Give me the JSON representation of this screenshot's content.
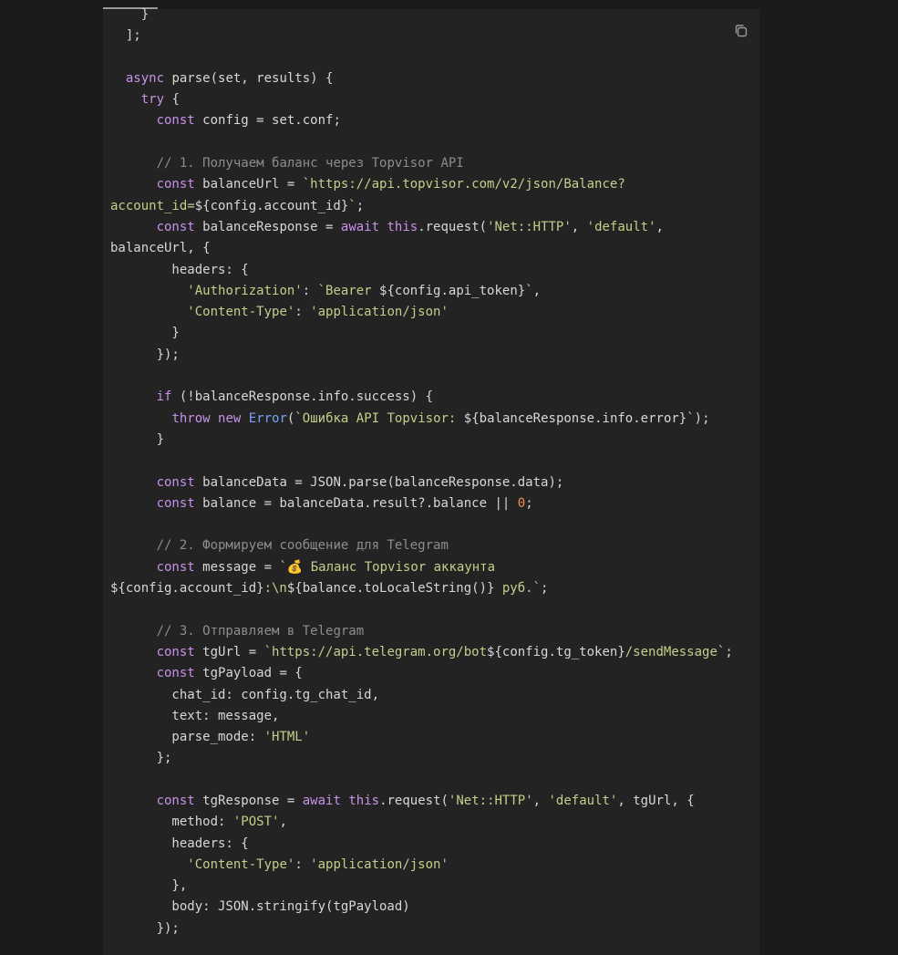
{
  "copy_button": {
    "icon": "copy-icon"
  },
  "colors": {
    "background": "#1b1b1b",
    "panel": "#232323",
    "keyword": "#c792ea",
    "string": "#c3cf8a",
    "comment": "#8d8d8d",
    "number": "#f08a4b",
    "class": "#7aa2f7",
    "text": "#d7d7d7"
  },
  "code_lines": [
    [
      [
        "pl",
        "    }"
      ]
    ],
    [
      [
        "pl",
        "  ];"
      ]
    ],
    [
      [
        "pl",
        ""
      ]
    ],
    [
      [
        "pl",
        "  "
      ],
      [
        "kw",
        "async"
      ],
      [
        "pl",
        " parse(set, results) {"
      ]
    ],
    [
      [
        "pl",
        "    "
      ],
      [
        "kw",
        "try"
      ],
      [
        "pl",
        " {"
      ]
    ],
    [
      [
        "pl",
        "      "
      ],
      [
        "kw",
        "const"
      ],
      [
        "pl",
        " config = set.conf;"
      ]
    ],
    [
      [
        "pl",
        ""
      ]
    ],
    [
      [
        "pl",
        "      "
      ],
      [
        "cm",
        "// 1. Получаем баланс через Topvisor API"
      ]
    ],
    [
      [
        "pl",
        "      "
      ],
      [
        "kw",
        "const"
      ],
      [
        "pl",
        " balanceUrl = "
      ],
      [
        "str",
        "`https://api.topvisor.com/v2/json/Balance?"
      ]
    ],
    [
      [
        "str",
        "account_id="
      ],
      [
        "pl",
        "${config.account_id}"
      ],
      [
        "str",
        "`"
      ],
      [
        "pl",
        ";"
      ]
    ],
    [
      [
        "pl",
        "      "
      ],
      [
        "kw",
        "const"
      ],
      [
        "pl",
        " balanceResponse = "
      ],
      [
        "kw",
        "await"
      ],
      [
        "pl",
        " "
      ],
      [
        "kw",
        "this"
      ],
      [
        "pl",
        ".request("
      ],
      [
        "str",
        "'Net::HTTP'"
      ],
      [
        "pl",
        ", "
      ],
      [
        "str",
        "'default'"
      ],
      [
        "pl",
        ","
      ]
    ],
    [
      [
        "pl",
        "balanceUrl, {"
      ]
    ],
    [
      [
        "pl",
        "        headers: {"
      ]
    ],
    [
      [
        "pl",
        "          "
      ],
      [
        "str",
        "'Authorization'"
      ],
      [
        "pl",
        ": "
      ],
      [
        "str",
        "`Bearer "
      ],
      [
        "pl",
        "${config.api_token}"
      ],
      [
        "str",
        "`"
      ],
      [
        "pl",
        ","
      ]
    ],
    [
      [
        "pl",
        "          "
      ],
      [
        "str",
        "'Content-Type'"
      ],
      [
        "pl",
        ": "
      ],
      [
        "str",
        "'application/json'"
      ]
    ],
    [
      [
        "pl",
        "        }"
      ]
    ],
    [
      [
        "pl",
        "      });"
      ]
    ],
    [
      [
        "pl",
        ""
      ]
    ],
    [
      [
        "pl",
        "      "
      ],
      [
        "kw",
        "if"
      ],
      [
        "pl",
        " (!balanceResponse.info.success) {"
      ]
    ],
    [
      [
        "pl",
        "        "
      ],
      [
        "kw",
        "throw"
      ],
      [
        "pl",
        " "
      ],
      [
        "kw",
        "new"
      ],
      [
        "pl",
        " "
      ],
      [
        "cls",
        "Error"
      ],
      [
        "pl",
        "("
      ],
      [
        "str",
        "`Ошибка API Topvisor: "
      ],
      [
        "pl",
        "${balanceResponse.info.error}"
      ],
      [
        "str",
        "`"
      ],
      [
        "pl",
        ");"
      ]
    ],
    [
      [
        "pl",
        "      }"
      ]
    ],
    [
      [
        "pl",
        ""
      ]
    ],
    [
      [
        "pl",
        "      "
      ],
      [
        "kw",
        "const"
      ],
      [
        "pl",
        " balanceData = JSON.parse(balanceResponse.data);"
      ]
    ],
    [
      [
        "pl",
        "      "
      ],
      [
        "kw",
        "const"
      ],
      [
        "pl",
        " balance = balanceData.result?.balance || "
      ],
      [
        "num",
        "0"
      ],
      [
        "pl",
        ";"
      ]
    ],
    [
      [
        "pl",
        ""
      ]
    ],
    [
      [
        "pl",
        "      "
      ],
      [
        "cm",
        "// 2. Формируем сообщение для Telegram"
      ]
    ],
    [
      [
        "pl",
        "      "
      ],
      [
        "kw",
        "const"
      ],
      [
        "pl",
        " message = "
      ],
      [
        "str",
        "`💰 Баланс Topvisor аккаунта"
      ]
    ],
    [
      [
        "pl",
        "${config.account_id}"
      ],
      [
        "str",
        ":\\n"
      ],
      [
        "pl",
        "${balance.toLocaleString()}"
      ],
      [
        "str",
        " руб.`"
      ],
      [
        "pl",
        ";"
      ]
    ],
    [
      [
        "pl",
        ""
      ]
    ],
    [
      [
        "pl",
        "      "
      ],
      [
        "cm",
        "// 3. Отправляем в Telegram"
      ]
    ],
    [
      [
        "pl",
        "      "
      ],
      [
        "kw",
        "const"
      ],
      [
        "pl",
        " tgUrl = "
      ],
      [
        "str",
        "`https://api.telegram.org/bot"
      ],
      [
        "pl",
        "${config.tg_token}"
      ],
      [
        "str",
        "/sendMessage`"
      ],
      [
        "pl",
        ";"
      ]
    ],
    [
      [
        "pl",
        "      "
      ],
      [
        "kw",
        "const"
      ],
      [
        "pl",
        " tgPayload = {"
      ]
    ],
    [
      [
        "pl",
        "        chat_id: config.tg_chat_id,"
      ]
    ],
    [
      [
        "pl",
        "        text: message,"
      ]
    ],
    [
      [
        "pl",
        "        parse_mode: "
      ],
      [
        "str",
        "'HTML'"
      ]
    ],
    [
      [
        "pl",
        "      };"
      ]
    ],
    [
      [
        "pl",
        ""
      ]
    ],
    [
      [
        "pl",
        "      "
      ],
      [
        "kw",
        "const"
      ],
      [
        "pl",
        " tgResponse = "
      ],
      [
        "kw",
        "await"
      ],
      [
        "pl",
        " "
      ],
      [
        "kw",
        "this"
      ],
      [
        "pl",
        ".request("
      ],
      [
        "str",
        "'Net::HTTP'"
      ],
      [
        "pl",
        ", "
      ],
      [
        "str",
        "'default'"
      ],
      [
        "pl",
        ", tgUrl, {"
      ]
    ],
    [
      [
        "pl",
        "        method: "
      ],
      [
        "str",
        "'POST'"
      ],
      [
        "pl",
        ","
      ]
    ],
    [
      [
        "pl",
        "        headers: {"
      ]
    ],
    [
      [
        "pl",
        "          "
      ],
      [
        "str",
        "'Content-Type'"
      ],
      [
        "pl",
        ": "
      ],
      [
        "str",
        "'application/json'"
      ]
    ],
    [
      [
        "pl",
        "        },"
      ]
    ],
    [
      [
        "pl",
        "        body: JSON.stringify(tgPayload)"
      ]
    ],
    [
      [
        "pl",
        "      });"
      ]
    ]
  ]
}
